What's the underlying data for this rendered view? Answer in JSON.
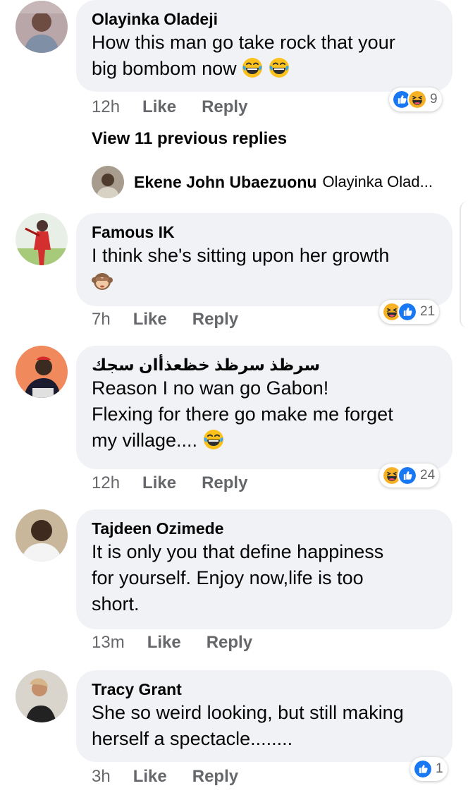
{
  "comments": [
    {
      "author": "Olayinka Oladeji",
      "lines": [
        "How this man go take rock that your",
        "big bombom now"
      ],
      "emoji_trailing": [
        "laugh-cry-emoji",
        "laugh-cry-emoji"
      ],
      "time": "12h",
      "like_label": "Like",
      "reply_label": "Reply",
      "reaction_icons": [
        "like-reaction-icon",
        "haha-reaction-icon"
      ],
      "reaction_count": "9"
    },
    {
      "author": "Famous IK",
      "lines": [
        "I think she's sitting upon her growth"
      ],
      "emoji_trailing": [
        "see-no-evil-monkey-emoji"
      ],
      "time": "7h",
      "like_label": "Like",
      "reply_label": "Reply",
      "reaction_icons": [
        "haha-reaction-icon",
        "like-reaction-icon"
      ],
      "reaction_count": "21"
    },
    {
      "author": "سرظذ سرظذ خظعذأان سجك",
      "lines": [
        "Reason I no wan go Gabon!",
        "Flexing for there go make me forget",
        "my village...."
      ],
      "emoji_trailing": [
        "laugh-cry-emoji"
      ],
      "time": "12h",
      "like_label": "Like",
      "reply_label": "Reply",
      "reaction_icons": [
        "haha-reaction-icon",
        "like-reaction-icon"
      ],
      "reaction_count": "24"
    },
    {
      "author": "Tajdeen Ozimede",
      "lines": [
        "It is only you that define happiness",
        "for yourself. Enjoy now,life is too",
        "short."
      ],
      "time": "13m",
      "like_label": "Like",
      "reply_label": "Reply"
    },
    {
      "author": "Tracy Grant",
      "lines": [
        "She so weird looking, but still making",
        "herself a spectacle........"
      ],
      "time": "3h",
      "like_label": "Like",
      "reply_label": "Reply",
      "reaction_icons": [
        "like-reaction-icon"
      ],
      "reaction_count": "1"
    }
  ],
  "view_previous": "View 11 previous replies",
  "reply_preview": {
    "author": "Ekene John Ubaezuonu",
    "snippet": "Olayinka Olad..."
  },
  "colors": {
    "bubble": "#f0f2f5",
    "meta": "#65676b",
    "like_blue": "#1877f2",
    "haha_yellow": "#f7b125"
  }
}
